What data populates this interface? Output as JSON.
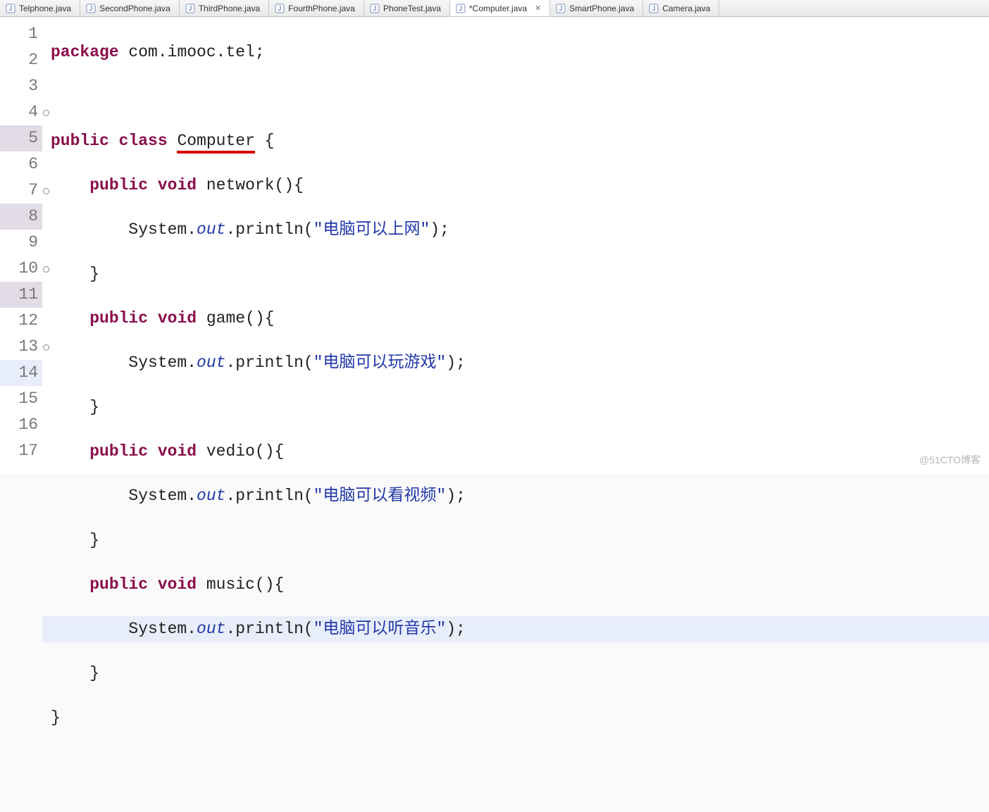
{
  "tabs": [
    {
      "label": "Telphone.java",
      "active": false,
      "dirty": false
    },
    {
      "label": "SecondPhone.java",
      "active": false,
      "dirty": false
    },
    {
      "label": "ThirdPhone.java",
      "active": false,
      "dirty": false
    },
    {
      "label": "FourthPhone.java",
      "active": false,
      "dirty": false
    },
    {
      "label": "PhoneTest.java",
      "active": false,
      "dirty": false
    },
    {
      "label": "*Computer.java",
      "active": true,
      "dirty": true,
      "closeGlyph": "✕"
    },
    {
      "label": "SmartPhone.java",
      "active": false,
      "dirty": false
    },
    {
      "label": "Camera.java",
      "active": false,
      "dirty": false
    }
  ],
  "code": {
    "line1": {
      "kw1": "package",
      "pkg": " com.imooc.tel",
      "semi": ";"
    },
    "line3": {
      "kw1": "public",
      "kw2": "class",
      "cls": "Computer",
      "brace": " {"
    },
    "method_network": {
      "kw1": "public",
      "kw2": "void",
      "name": " network()",
      "brace": "{"
    },
    "println_network": {
      "obj": "System.",
      "fld": "out",
      "call": ".println(",
      "str": "\"电脑可以上网\"",
      "end": ");"
    },
    "method_game": {
      "kw1": "public",
      "kw2": "void",
      "name": " game()",
      "brace": "{"
    },
    "println_game": {
      "obj": "System.",
      "fld": "out",
      "call": ".println(",
      "str": "\"电脑可以玩游戏\"",
      "end": ");"
    },
    "method_vedio": {
      "kw1": "public",
      "kw2": "void",
      "name": " vedio()",
      "brace": "{"
    },
    "println_vedio": {
      "obj": "System.",
      "fld": "out",
      "call": ".println(",
      "str": "\"电脑可以看视频\"",
      "end": ");"
    },
    "method_music": {
      "kw1": "public",
      "kw2": "void",
      "name": " music()",
      "brace": "{"
    },
    "println_music": {
      "obj": "System.",
      "fld": "out",
      "call": ".println(",
      "str": "\"电脑可以听音乐\"",
      "end": ");"
    },
    "close_brace": "}",
    "close_method": "}"
  },
  "lineNumbers": [
    "1",
    "2",
    "3",
    "4",
    "5",
    "6",
    "7",
    "8",
    "9",
    "10",
    "11",
    "12",
    "13",
    "14",
    "15",
    "16",
    "17"
  ],
  "watermark": "@51CTO博客"
}
